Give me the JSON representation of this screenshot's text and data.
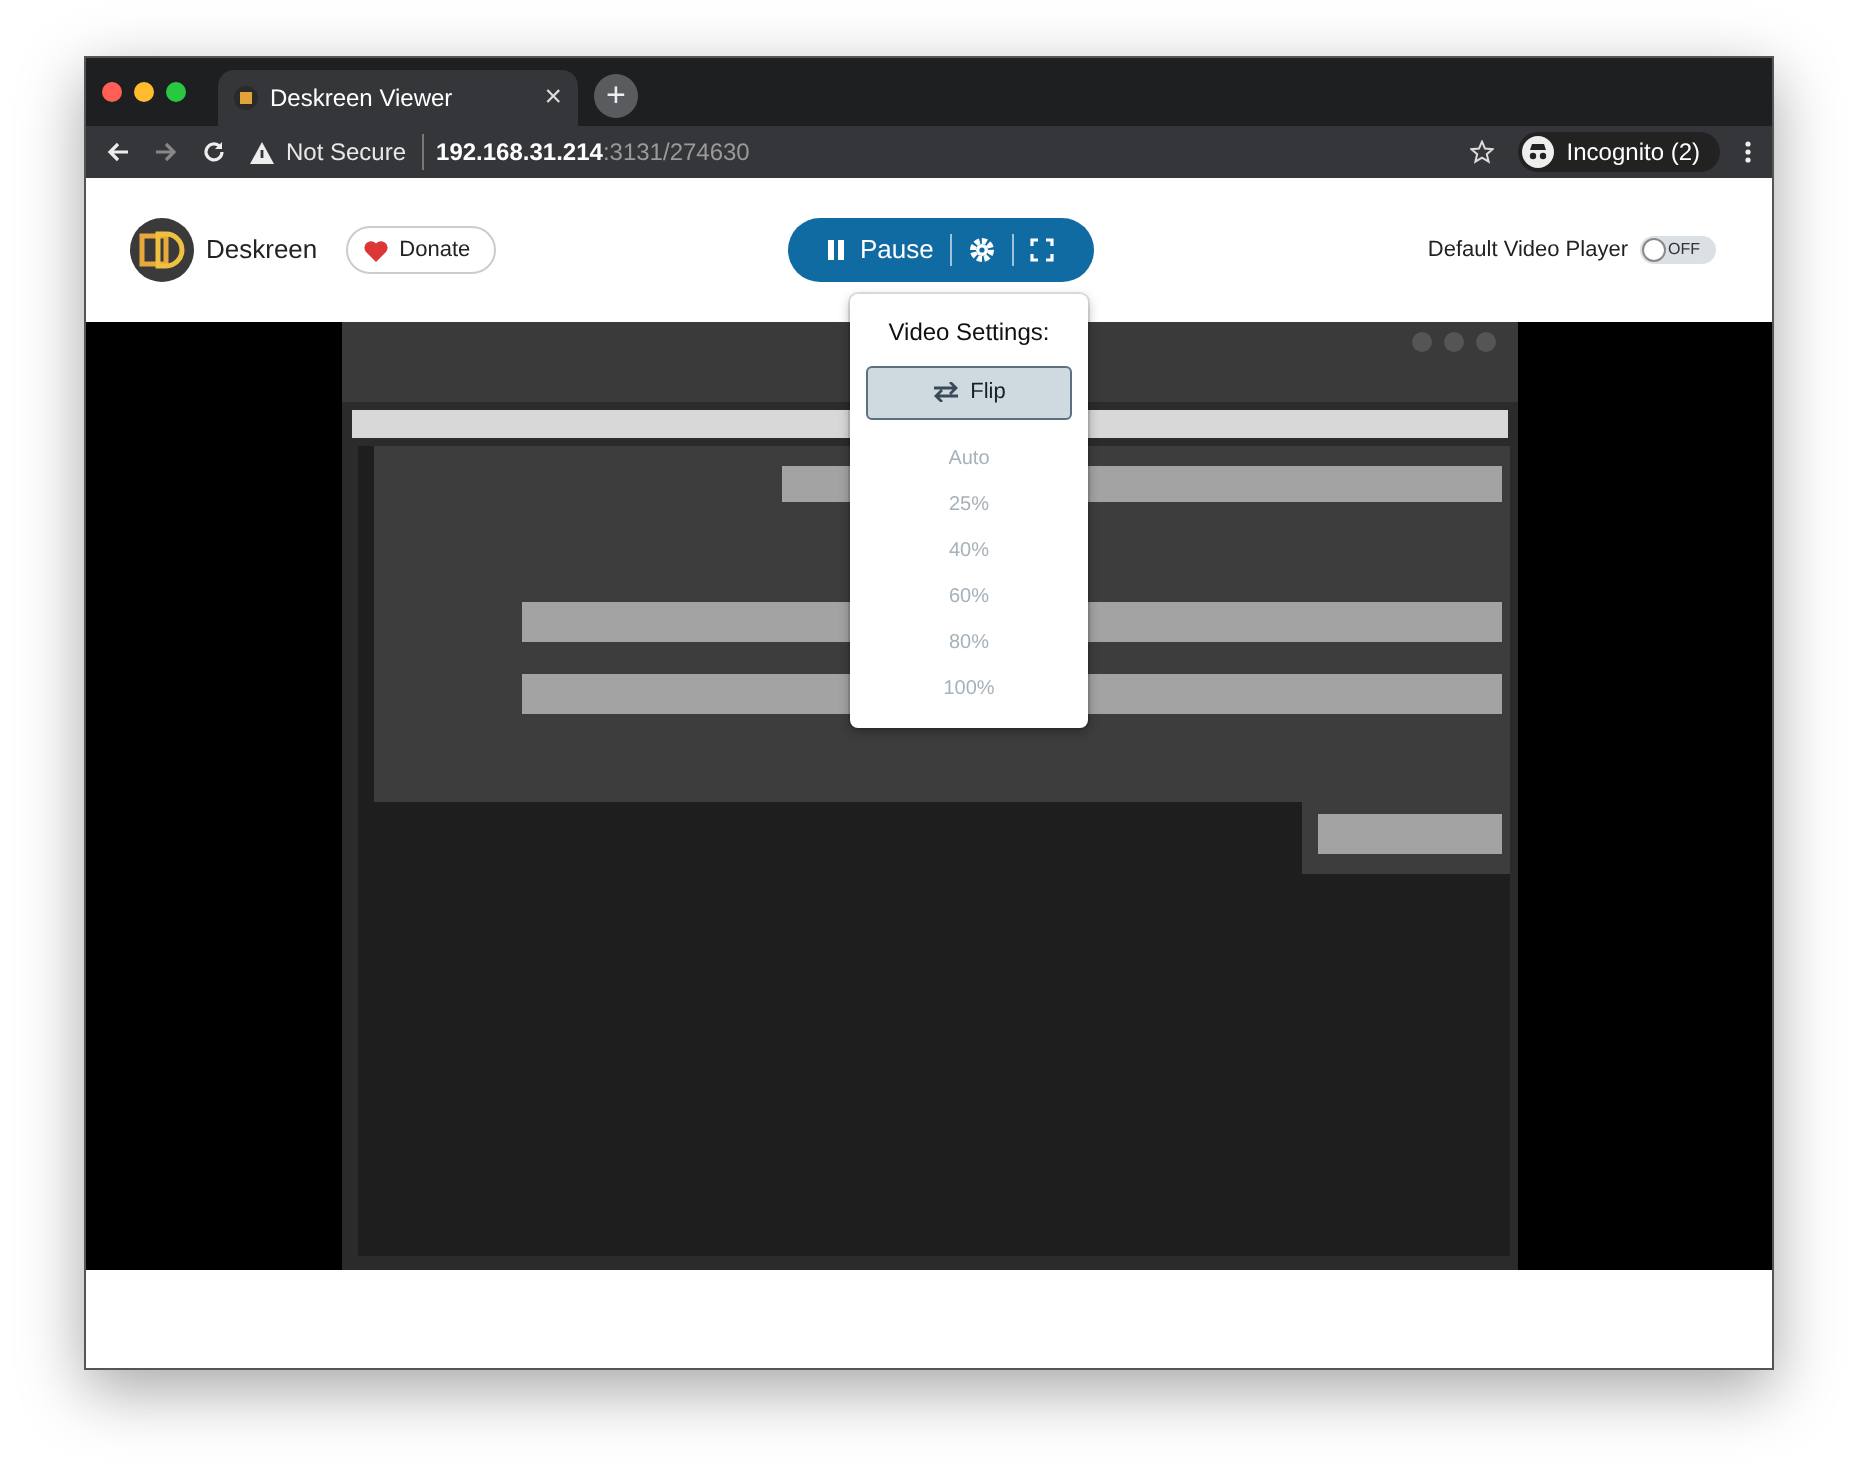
{
  "browser": {
    "tab": {
      "title": "Deskreen Viewer",
      "close": "×"
    },
    "new_tab": "+",
    "address_bar": {
      "security": "Not Secure",
      "host": "192.168.31.214",
      "path": ":3131/274630"
    },
    "profile": "Incognito (2)"
  },
  "header": {
    "brand": "Deskreen",
    "donate": "Donate",
    "pause": "Pause",
    "default_player": {
      "label": "Default Video Player",
      "on": false,
      "state_text": "OFF"
    }
  },
  "video_settings": {
    "title": "Video Settings:",
    "flip": "Flip",
    "quality_options": [
      {
        "label": "Auto",
        "disabled": true
      },
      {
        "label": "25%",
        "disabled": true
      },
      {
        "label": "40%",
        "disabled": true
      },
      {
        "label": "60%",
        "disabled": true
      },
      {
        "label": "80%",
        "disabled": true
      },
      {
        "label": "100%",
        "disabled": true
      }
    ]
  }
}
